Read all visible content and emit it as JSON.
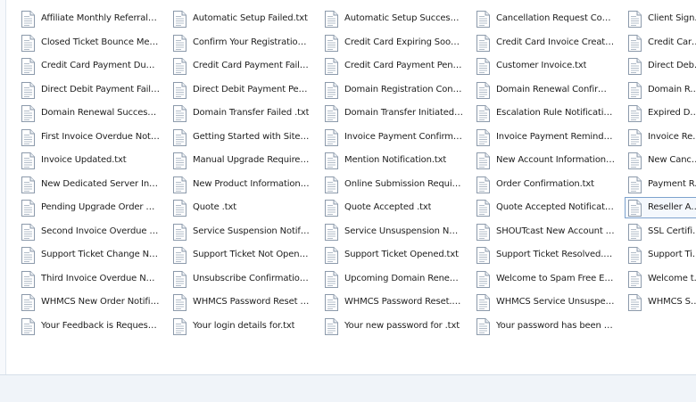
{
  "files": [
    [
      "Affiliate Monthly Referrals Report....",
      "Closed Ticket Bounce Message.txt",
      "Credit Card Payment Due.txt",
      "Direct Debit Payment Failed.txt",
      "Domain Renewal Successful.txt",
      "First Invoice Overdue Notice.txt",
      "Invoice Updated.txt",
      "New Dedicated Server Informatio...",
      "Pending Upgrade Order Cancelle...",
      "Second Invoice Overdue Notice.txt",
      "Support Ticket Change Notificati...",
      "Third Invoice Overdue Notice.txt",
      "WHMCS New Order Notification.txt",
      "Your Feedback is Requested for Ti..."
    ],
    [
      "Automatic Setup Failed.txt",
      "Confirm Your Registration.txt",
      "Credit Card Payment Failed.txt",
      "Direct Debit Payment Pending.txt",
      "Domain Transfer Failed .txt",
      "Getting Started with SiteLock.txt",
      "Manual Upgrade Required.txt",
      "New Product Information.txt",
      "Quote .txt",
      "Service Suspension Notification.txt",
      "Support Ticket Not Opened.txt",
      "Unsubscribe Confirmation.txt",
      "WHMCS Password Reset Confirm...",
      "Your login details for.txt"
    ],
    [
      "Automatic Setup Successful.txt",
      "Credit Card Expiring Soon.txt",
      "Credit Card Payment Pending.txt",
      "Domain Registration Confirmatio...",
      "Domain Transfer Initiated.txt",
      "Invoice Payment Confirmation.txt",
      "Mention Notification.txt",
      "Online Submission Required.txt",
      "Quote Accepted .txt",
      "Service Unsuspension Notificatio...",
      "Support Ticket Opened.txt",
      "Upcoming Domain Renewal Noti...",
      "WHMCS Password Reset.txt",
      "Your new password for .txt"
    ],
    [
      "Cancellation Request Confirmatio...",
      "Credit Card Invoice Created.txt",
      "Customer Invoice.txt",
      "Domain Renewal Confirmation.txt",
      "Escalation Rule Notification.txt",
      "Invoice Payment Reminder.txt",
      "New Account Information.txt",
      "Order Confirmation.txt",
      "Quote Accepted Notification.txt",
      "SHOUTcast New Account Inform...",
      "Support Ticket Resolved.txt",
      "Welcome to Spam Free Email.txt",
      "WHMCS Service Unsuspension Fa...",
      "Your password has been reset for ..."
    ],
    [
      "Client Signup E",
      "Credit Card Pa",
      "Direct Debit Pa",
      "Domain Renew",
      "Expired Domai",
      "Invoice Refunc",
      "New Cancellat",
      "Payment Rever",
      "Reseller Accou",
      "SSL Certificate",
      "Support Ticket",
      "Welcome to yo",
      "WHMCS Servic"
    ]
  ],
  "selected": {
    "column": 4,
    "row": 8
  },
  "icon": "text-document-icon",
  "colors": {
    "selection_border": "#7da2ce",
    "pane_background": "#ffffff",
    "status_bar": "#f0f4f9"
  }
}
